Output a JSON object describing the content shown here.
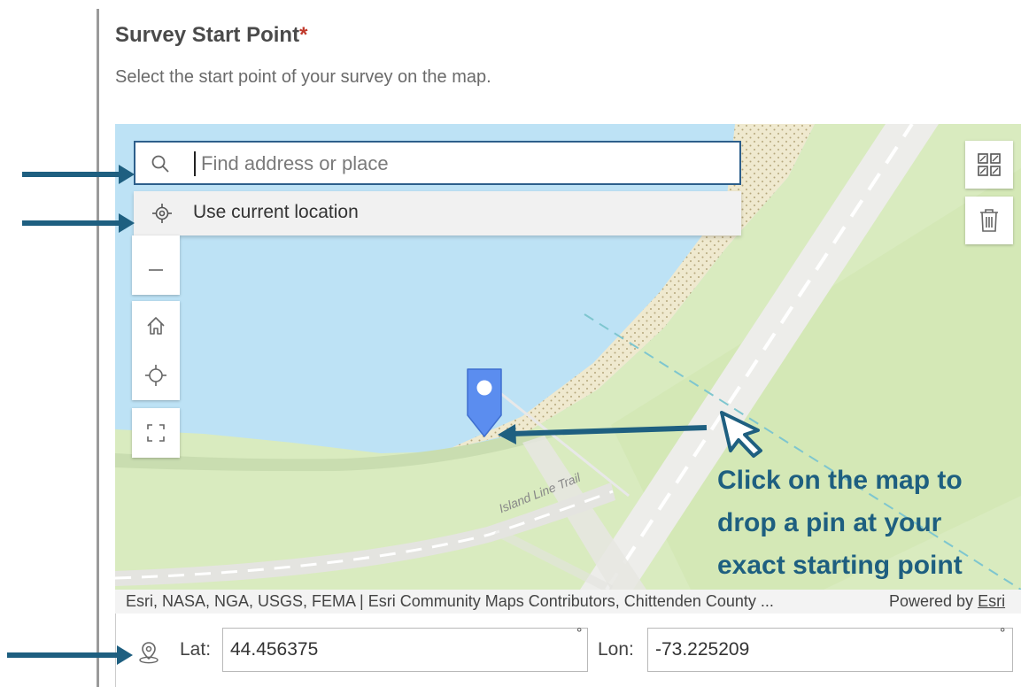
{
  "header": {
    "title": "Survey Start Point",
    "required_mark": "*",
    "subtitle": "Select the start point of your survey on the map."
  },
  "map": {
    "search": {
      "placeholder": "Find address or place",
      "value": ""
    },
    "suggestion": {
      "label": "Use current location"
    },
    "trail_label": "Island Line Trail",
    "attribution": {
      "credits": "Esri, NASA, NGA, USGS, FEMA | Esri Community Maps Contributors, Chittenden County ...",
      "powered_by": "Powered by",
      "esri_link": "Esri"
    },
    "icons": {
      "search": "search-icon",
      "location": "crosshair-icon",
      "zoom_out": "minus-icon",
      "home": "home-icon",
      "locate": "locate-icon",
      "fullscreen": "fullscreen-icon",
      "basemap": "basemap-gallery-icon",
      "delete": "trash-icon",
      "pin": "map-pin-icon"
    }
  },
  "coordinates": {
    "lat_label": "Lat:",
    "lat_value": "44.456375",
    "lon_label": "Lon:",
    "lon_value": "-73.225209",
    "degree_symbol": "°"
  },
  "callout": {
    "lines": [
      "Click on the map to",
      "drop a pin at your",
      "exact starting point"
    ]
  },
  "colors": {
    "annotation": "#1e5f80",
    "water": "#bde2f5",
    "land": "#d9ebbf",
    "pin": "#5b8def",
    "required": "#c0392b"
  }
}
